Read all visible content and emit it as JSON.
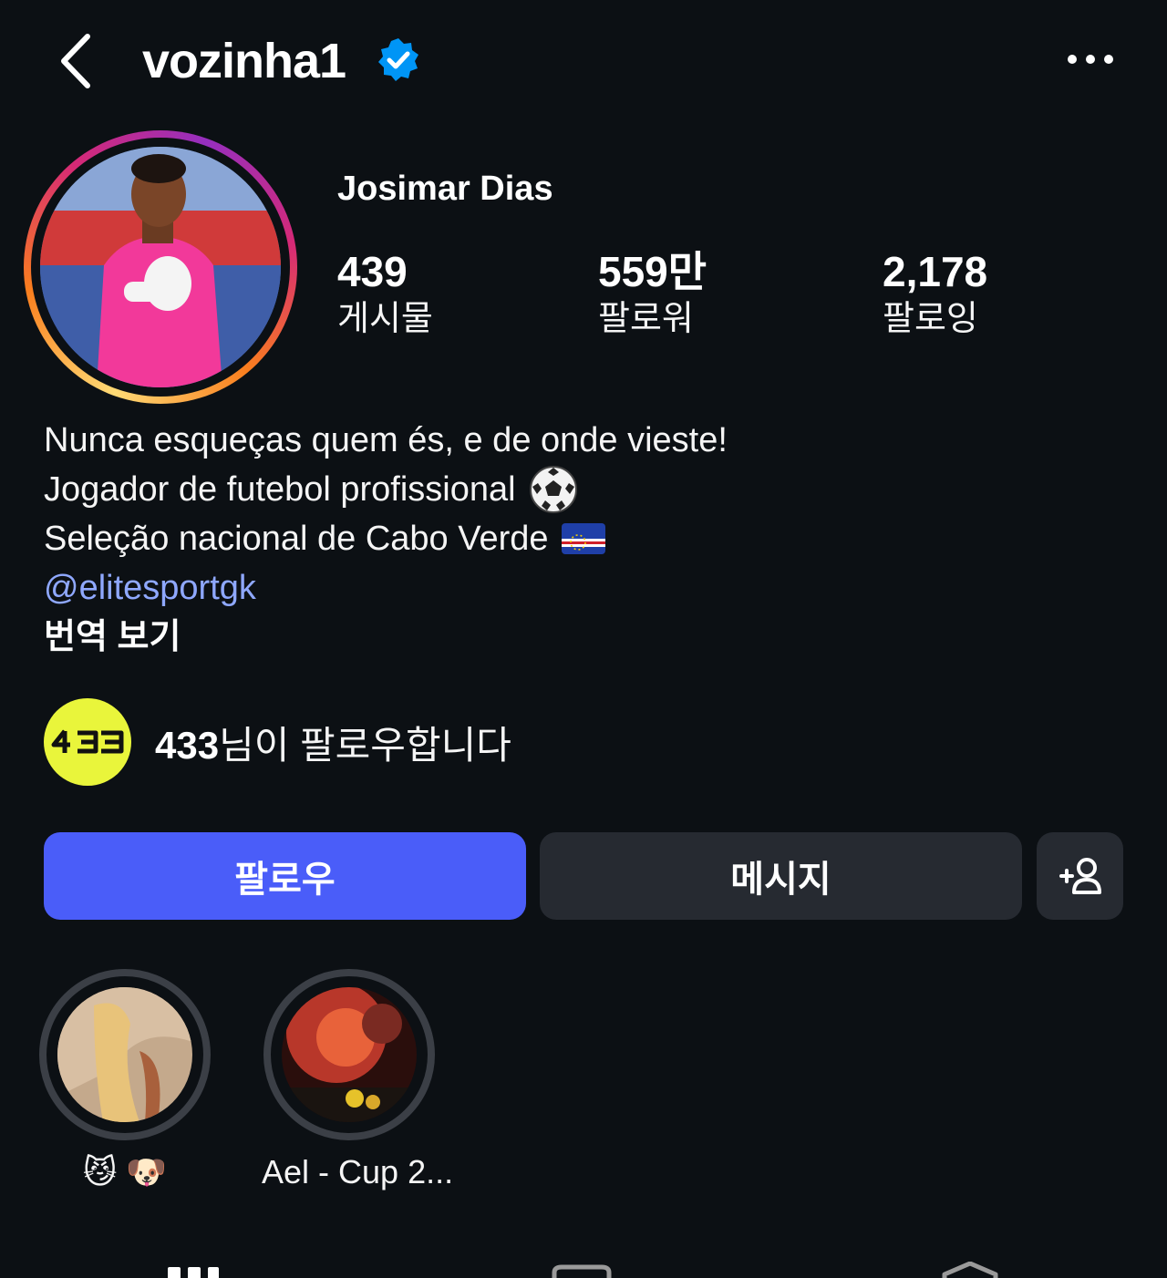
{
  "header": {
    "username": "vozinha1",
    "verified_icon": "verified-badge-icon",
    "back_icon": "chevron-left-icon",
    "more_icon": "more-horizontal-icon"
  },
  "profile": {
    "full_name": "Josimar Dias",
    "stats": [
      {
        "value": "439",
        "label": "게시물"
      },
      {
        "value": "559만",
        "label": "팔로워"
      },
      {
        "value": "2,178",
        "label": "팔로잉"
      }
    ]
  },
  "bio": {
    "line1": "Nunca esqueças quem és, e de onde vieste!",
    "line2": "Jogador de futebol profissional",
    "line3": "Seleção nacional de Cabo Verde",
    "mention": "@elitesportgk",
    "translate": "번역 보기"
  },
  "followed_by": {
    "logo_text": "433",
    "name": "433",
    "suffix": "님이 팔로우합니다"
  },
  "actions": {
    "follow": "팔로우",
    "message": "메시지",
    "add_person_icon": "add-person-icon"
  },
  "highlights": [
    {
      "label": "😼 🐶"
    },
    {
      "label": "Ael - Cup 2..."
    }
  ],
  "colors": {
    "background": "#0c1014",
    "follow_button": "#4a5df9",
    "secondary_button": "#262a31",
    "mention": "#8fa8ff",
    "verified": "#0095f6",
    "followed_logo_bg": "#e9f53b"
  }
}
